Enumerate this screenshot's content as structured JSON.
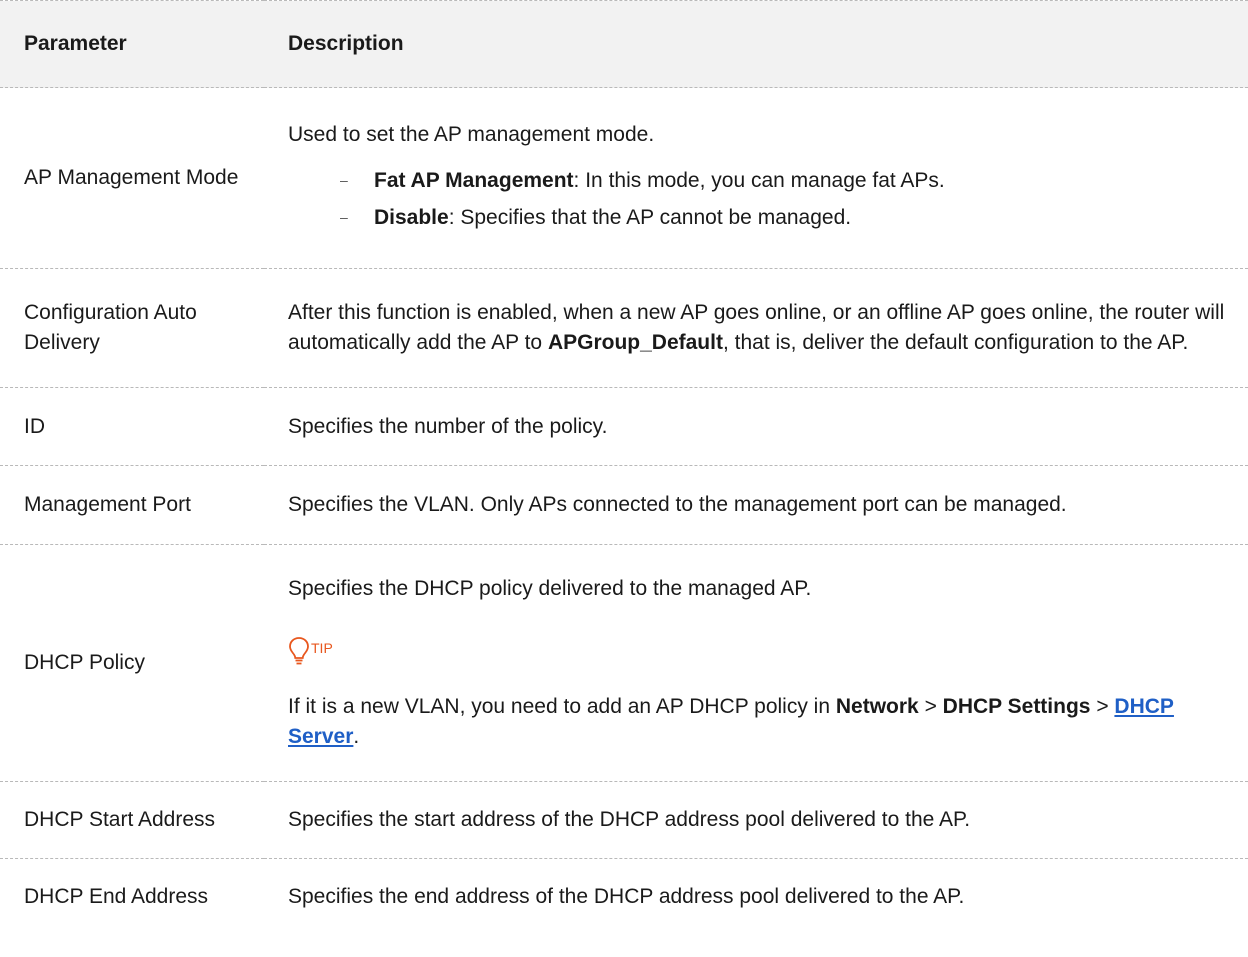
{
  "header": {
    "parameter": "Parameter",
    "description": "Description"
  },
  "rows": {
    "mode": {
      "param": "AP Management Mode",
      "intro": "Used to set the AP management mode.",
      "opt1_term": "Fat AP Management",
      "opt1_text": ": In this mode, you can manage fat APs.",
      "opt2_term": "Disable",
      "opt2_text": ": Specifies that the AP cannot be managed.",
      "bullet": "–"
    },
    "auto": {
      "param": "Configuration Auto Delivery",
      "text_before": "After this function is enabled, when a new AP goes online, or an offline AP goes online, the router will automatically add the AP to ",
      "term": "APGroup_Default",
      "text_after": ", that is, deliver the default configuration to the AP."
    },
    "id": {
      "param": "ID",
      "desc": "Specifies the number of the policy."
    },
    "port": {
      "param": "Management Port",
      "desc": "Specifies the VLAN. Only APs connected to the management port can be managed."
    },
    "dhcp": {
      "param": "DHCP Policy",
      "desc": "Specifies the DHCP policy delivered to the managed AP.",
      "tip_label": "TIP",
      "tip_text": "If it is a new VLAN, you need to add an AP DHCP policy in ",
      "nav1": "Network",
      "sep1": " > ",
      "nav2": "DHCP Settings",
      "sep2": " > ",
      "nav3": "DHCP Server",
      "end": "."
    },
    "start": {
      "param": "DHCP Start Address",
      "desc": "Specifies the start address of the DHCP address pool delivered to the AP."
    },
    "end": {
      "param": "DHCP End Address",
      "desc": "Specifies the end address of the DHCP address pool delivered to the AP."
    }
  },
  "colors": {
    "tip_orange": "#e8571e",
    "link_blue": "#1f5fc6",
    "header_bg": "#f2f2f2"
  },
  "icons": {
    "tip": "lightbulb-icon"
  }
}
